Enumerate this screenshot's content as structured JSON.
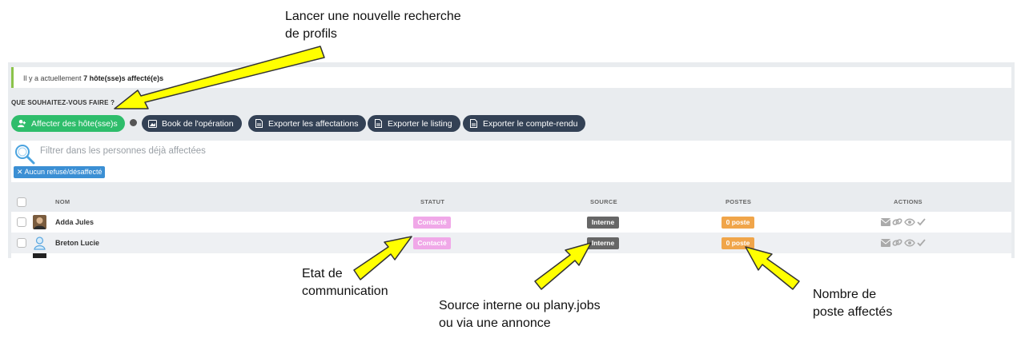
{
  "annotations": {
    "search_new": "Lancer une nouvelle recherche\nde profils",
    "comm_state": "Etat de\ncommunication",
    "source": "Source interne ou plany.jobs\nou via une annonce",
    "posts": "Nombre de\nposte affectés"
  },
  "info": {
    "prefix": "Il y a actuellement",
    "count": "7 hôte(sse)s affecté(e)s"
  },
  "question": "QUE SOUHAITEZ-VOUS FAIRE ?",
  "toolbar": {
    "assign": "Affecter des hôte(sse)s",
    "book": "Book de l'opération",
    "export_assign": "Exporter les affectations",
    "export_listing": "Exporter le listing",
    "export_report": "Exporter le compte-rendu"
  },
  "filter": {
    "placeholder": "Filtrer dans les personnes déjà affectées",
    "tag": "✕ Aucun refusé/désaffecté"
  },
  "table": {
    "headers": {
      "name": "NOM",
      "status": "STATUT",
      "source": "SOURCE",
      "posts": "POSTES",
      "actions": "ACTIONS"
    },
    "rows": [
      {
        "name": "Adda Jules",
        "status": "Contacté",
        "source": "Interne",
        "posts": "0 poste"
      },
      {
        "name": "Breton Lucie",
        "status": "Contacté",
        "source": "Interne",
        "posts": "0 poste"
      }
    ]
  },
  "icons": {
    "assign": "add-user-icon",
    "book": "image-icon",
    "export": "document-export-icon",
    "filter": "magnifier-icon",
    "actions": [
      "envelope-icon",
      "link-icon",
      "eye-icon",
      "check-icon"
    ]
  },
  "colors": {
    "green": "#2ebd6b",
    "dark_button": "#334155",
    "status_contact": "#f0a8e8",
    "source_badge": "#666666",
    "posts_badge": "#f0a54a",
    "tag_blue": "#3b8fd4",
    "arrow_fill": "#ffff00"
  }
}
